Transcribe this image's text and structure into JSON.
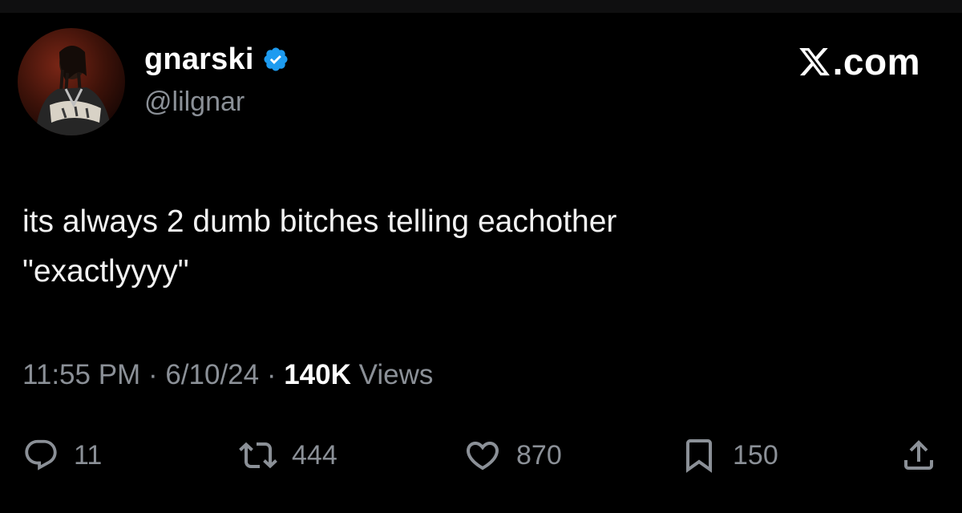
{
  "author": {
    "display_name": "gnarski",
    "handle": "@lilgnar",
    "verified_icon": "verified-badge-icon"
  },
  "brand": {
    "label": ".com",
    "icon": "x-logo-icon"
  },
  "tweet": {
    "line1": "its always 2 dumb bitches telling eachother",
    "line2": "\"exactlyyyy\""
  },
  "meta": {
    "time": "11:55 PM",
    "sep1": " · ",
    "date": "6/10/24",
    "sep2": " · ",
    "views_count": "140K",
    "views_label": " Views"
  },
  "actions": {
    "replies": "11",
    "reposts": "444",
    "likes": "870",
    "bookmarks": "150"
  },
  "colors": {
    "background": "#000000",
    "text": "#e7e9ea",
    "muted": "#8b9097",
    "verified": "#1d9bf0"
  }
}
